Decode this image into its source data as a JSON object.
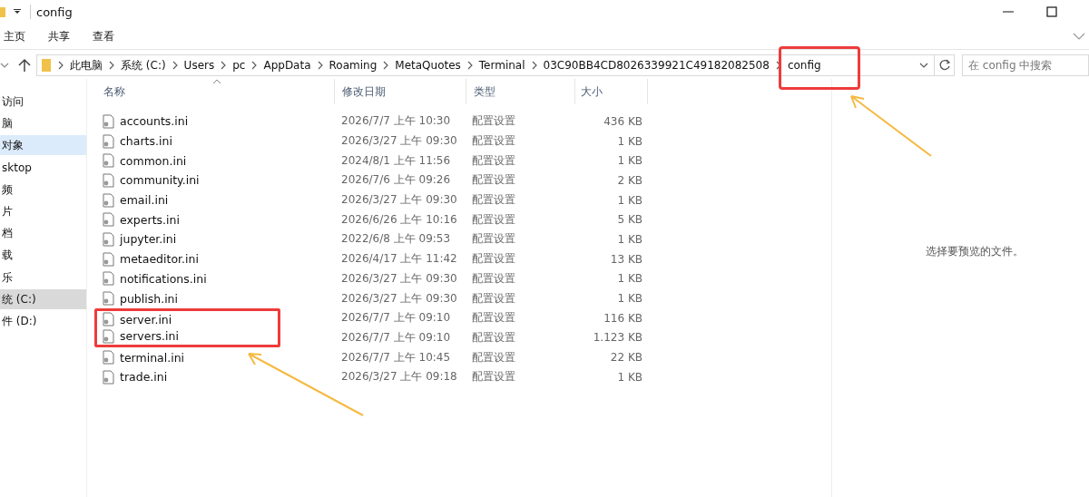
{
  "window": {
    "title": "config"
  },
  "ribbon_tabs": [
    {
      "label": "主页",
      "selected": false
    },
    {
      "label": "共享",
      "selected": false
    },
    {
      "label": "查看",
      "selected": false
    }
  ],
  "address": {
    "highlighted": true,
    "crumbs": [
      "此电脑",
      "系统 (C:)",
      "Users",
      "pc",
      "AppData",
      "Roaming",
      "MetaQuotes",
      "Terminal",
      "03C90BB4CD8026339921C49182082508",
      "config"
    ]
  },
  "search": {
    "placeholder": "在 config 中搜索"
  },
  "sidebar": {
    "items": [
      {
        "label": "访问",
        "selected": false,
        "hovered": false
      },
      {
        "label": "脑",
        "selected": false,
        "hovered": false
      },
      {
        "label": "对象",
        "selected": true,
        "hovered": false
      },
      {
        "label": "sktop",
        "selected": false,
        "hovered": false
      },
      {
        "label": "频",
        "selected": false,
        "hovered": false
      },
      {
        "label": "片",
        "selected": false,
        "hovered": false
      },
      {
        "label": "档",
        "selected": false,
        "hovered": false
      },
      {
        "label": "载",
        "selected": false,
        "hovered": false
      },
      {
        "label": "乐",
        "selected": false,
        "hovered": false
      },
      {
        "label": "统 (C:)",
        "selected": false,
        "hovered": true
      },
      {
        "label": "件 (D:)",
        "selected": false,
        "hovered": false
      }
    ]
  },
  "table": {
    "columns": [
      "名称",
      "修改日期",
      "类型",
      "大小"
    ],
    "rows": [
      {
        "name": "accounts.ini",
        "modified": "2026/7/7 上午 10:30",
        "type": "配置设置",
        "size": "436 KB",
        "highlighted": false
      },
      {
        "name": "charts.ini",
        "modified": "2026/3/27 上午 09:30",
        "type": "配置设置",
        "size": "1 KB",
        "highlighted": false
      },
      {
        "name": "common.ini",
        "modified": "2024/8/1 上午 11:56",
        "type": "配置设置",
        "size": "1 KB",
        "highlighted": false
      },
      {
        "name": "community.ini",
        "modified": "2026/7/6 上午 09:26",
        "type": "配置设置",
        "size": "2 KB",
        "highlighted": false
      },
      {
        "name": "email.ini",
        "modified": "2026/3/27 上午 09:30",
        "type": "配置设置",
        "size": "1 KB",
        "highlighted": false
      },
      {
        "name": "experts.ini",
        "modified": "2026/6/26 上午 10:16",
        "type": "配置设置",
        "size": "5 KB",
        "highlighted": false
      },
      {
        "name": "jupyter.ini",
        "modified": "2022/6/8 上午 09:53",
        "type": "配置设置",
        "size": "1 KB",
        "highlighted": false
      },
      {
        "name": "metaeditor.ini",
        "modified": "2026/4/17 上午 11:42",
        "type": "配置设置",
        "size": "13 KB",
        "highlighted": false
      },
      {
        "name": "notifications.ini",
        "modified": "2026/3/27 上午 09:30",
        "type": "配置设置",
        "size": "1 KB",
        "highlighted": false
      },
      {
        "name": "publish.ini",
        "modified": "2026/3/27 上午 09:30",
        "type": "配置设置",
        "size": "1 KB",
        "highlighted": false
      },
      {
        "name": "server.ini",
        "modified": "2026/7/7 上午 09:10",
        "type": "配置设置",
        "size": "116 KB",
        "highlighted": true
      },
      {
        "name": "servers.ini",
        "modified": "2026/7/7 上午 09:10",
        "type": "配置设置",
        "size": "1.123 KB",
        "highlighted": true
      },
      {
        "name": "terminal.ini",
        "modified": "2026/7/7 上午 10:45",
        "type": "配置设置",
        "size": "22 KB",
        "highlighted": false
      },
      {
        "name": "trade.ini",
        "modified": "2026/3/27 上午 09:18",
        "type": "配置设置",
        "size": "1 KB",
        "highlighted": false
      }
    ]
  },
  "preview": {
    "message": "选择要预览的文件。"
  }
}
